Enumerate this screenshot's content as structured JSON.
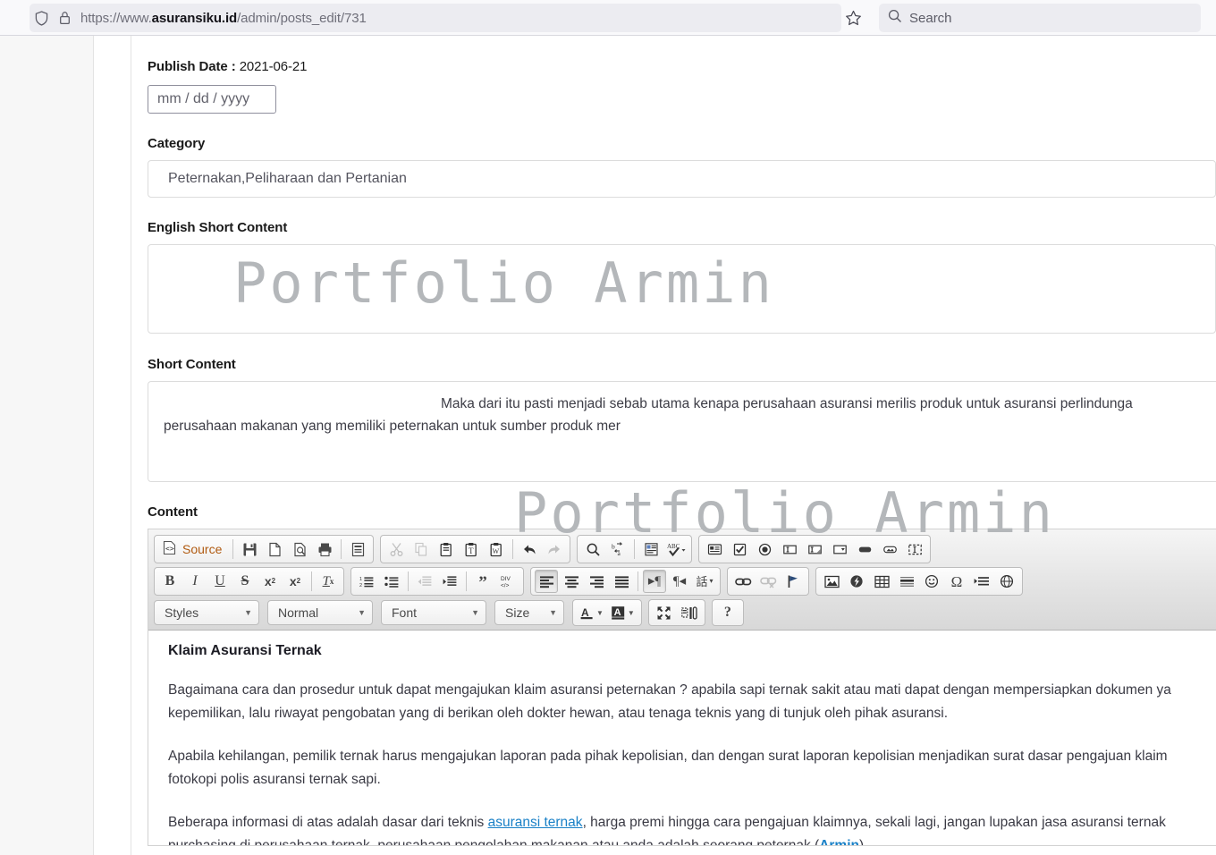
{
  "browser": {
    "url_prefix": "https://www.",
    "url_domain": "asuransiku.id",
    "url_path": "/admin/posts_edit/731",
    "search_placeholder": "Search",
    "shield_icon": "shield-icon",
    "lock_icon": "lock-icon",
    "star_icon": "star-icon",
    "search_icon": "search-icon"
  },
  "form": {
    "publish_date_label": "Publish Date : ",
    "publish_date_value": "2021-06-21",
    "date_input_placeholder": "mm / dd / yyyy",
    "category_label": "Category",
    "category_value": "Peternakan,Peliharaan dan Pertanian",
    "english_short_label": "English Short Content",
    "english_short_watermark": "Portfolio Armin",
    "short_label": "Short Content",
    "short_line1": "Maka dari itu pasti menjadi sebab utama kenapa perusahaan asuransi merilis produk untuk asuransi perlindunga",
    "short_line2": "perusahaan makanan yang memiliki peternakan untuk sumber produk mer",
    "content_label": "Content",
    "content_watermark": "Portfolio Armin"
  },
  "editor": {
    "source_label": "Source",
    "combo_styles": "Styles",
    "combo_format": "Normal",
    "combo_font": "Font",
    "combo_size": "Size",
    "caret": "▾",
    "toolbar_row1_group1": [
      "source-icon",
      "save-icon",
      "new-page-icon",
      "preview-icon",
      "print-icon",
      "templates-icon"
    ],
    "toolbar_row1_group2": [
      "cut-icon",
      "copy-icon",
      "paste-icon",
      "paste-text-icon",
      "paste-word-icon",
      "undo-icon",
      "redo-icon"
    ],
    "toolbar_row1_group3": [
      "find-icon",
      "replace-icon",
      "select-all-icon",
      "spellcheck-icon"
    ],
    "toolbar_row1_group4": [
      "form-icon",
      "checkbox-icon",
      "radio-icon",
      "text-field-icon",
      "textarea-icon",
      "select-field-icon",
      "button-icon",
      "image-button-icon",
      "hidden-field-icon"
    ],
    "toolbar_row2_group1": [
      "bold-icon",
      "italic-icon",
      "underline-icon",
      "strikethrough-icon",
      "subscript-icon",
      "superscript-icon",
      "remove-format-icon"
    ],
    "toolbar_row2_group2": [
      "numbered-list-icon",
      "bulleted-list-icon",
      "decrease-indent-icon",
      "increase-indent-icon",
      "blockquote-icon",
      "div-container-icon"
    ],
    "toolbar_row2_group3": [
      "align-left-icon",
      "align-center-icon",
      "align-right-icon",
      "justify-icon",
      "ltr-icon",
      "rtl-icon",
      "language-icon"
    ],
    "toolbar_row2_group4": [
      "link-icon",
      "unlink-icon",
      "anchor-icon"
    ],
    "toolbar_row2_group5": [
      "image-icon",
      "flash-icon",
      "table-icon",
      "horizontal-rule-icon",
      "smiley-icon",
      "special-char-icon",
      "page-break-icon",
      "iframe-icon"
    ],
    "toolbar_row3_group1": [
      "text-color-icon",
      "background-color-icon"
    ],
    "toolbar_row3_group2": [
      "maximize-icon",
      "show-blocks-icon"
    ],
    "toolbar_row3_group3": [
      "about-icon"
    ],
    "about_label": "?"
  },
  "content": {
    "heading": "Klaim Asuransi Ternak",
    "p1_line1": "Bagaimana cara dan prosedur untuk dapat mengajukan klaim asuransi peternakan ? apabila sapi ternak sakit atau mati dapat dengan mempersiapkan dokumen ya",
    "p1_line2": "kepemilikan, lalu riwayat pengobatan yang di berikan oleh dokter hewan, atau tenaga teknis yang di tunjuk oleh pihak asuransi.",
    "p2_line1": "Apabila kehilangan, pemilik ternak harus mengajukan laporan pada pihak kepolisian, dan dengan surat laporan kepolisian menjadikan surat dasar pengajuan klaim",
    "p2_line2": "fotokopi polis asuransi ternak sapi.",
    "p3_a": "Beberapa informasi di atas adalah dasar dari teknis ",
    "p3_link": "asuransi ternak",
    "p3_b": ", harga premi hingga cara pengajuan klaimnya, sekali lagi, jangan lupakan jasa asuransi ternak",
    "p3_c": "purchasing di perusahaan ternak, perusahaan pengolahan makanan atau anda adalah seorang peternak.(",
    "p3_link2": "Armin",
    "p3_d": ")"
  },
  "colors": {
    "link": "#1a81c7",
    "watermark": "#b4b7ba",
    "toolbar_bg": "#e4e4e4",
    "page_bg": "#ffffff"
  }
}
